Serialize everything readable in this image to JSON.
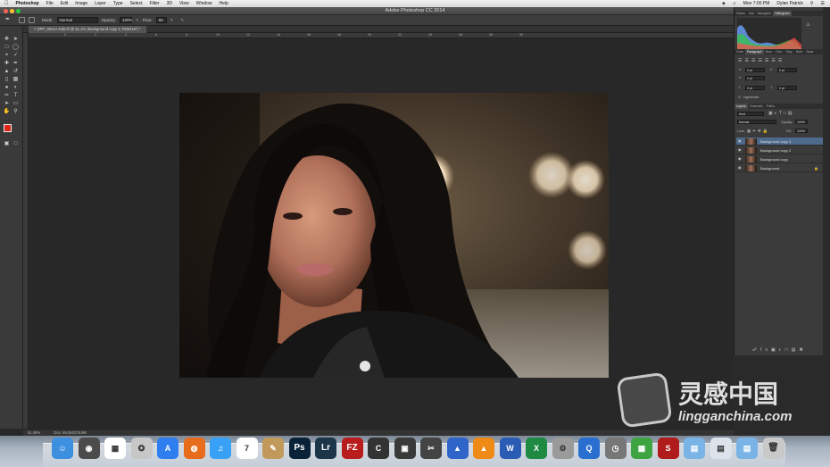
{
  "menubar": {
    "app": "Photoshop",
    "items": [
      "File",
      "Edit",
      "Image",
      "Layer",
      "Type",
      "Select",
      "Filter",
      "3D",
      "View",
      "Window",
      "Help"
    ],
    "clock": "Mon 7:00 PM",
    "user": "Dylan Patrick"
  },
  "window": {
    "title": "Adobe Photoshop CC 2014"
  },
  "options": {
    "mode_label": "Mode:",
    "mode_value": "Normal",
    "opacity_label": "Opacity:",
    "opacity_value": "100%",
    "flow_label": "Flow:",
    "flow_value": "66"
  },
  "document": {
    "tab": "DPP_0021A-Edit.tif @ 51.1% (Background copy 3, RGB/16*) *"
  },
  "ruler": {
    "marks": [
      "0",
      "2",
      "4",
      "6",
      "8",
      "10",
      "12",
      "14",
      "16",
      "18",
      "20",
      "22",
      "24",
      "26",
      "28",
      "30"
    ]
  },
  "status": {
    "zoom": "51.09%",
    "doc": "Doc: 69.0M/275.9M"
  },
  "panels": {
    "histogram_tabs": [
      "Styles",
      "Info",
      "Navigator",
      "Histogram"
    ],
    "active_histogram_tab": "Histogram",
    "para_tabs": [
      "Char",
      "Paragraph",
      "Brus",
      "Clon",
      "Glyp",
      "Note",
      "Swat"
    ],
    "active_para_tab": "Paragraph",
    "para_fields": [
      "0 pt",
      "0 pt",
      "0 pt",
      "0 pt",
      "0 pt"
    ],
    "hyphenate": "Hyphenate",
    "layers_tabs": [
      "Layers",
      "Channels",
      "Paths"
    ],
    "active_layers_tab": "Layers",
    "kind": "Kind",
    "blend": "Normal",
    "opacity_label": "Opacity:",
    "opacity_value": "100%",
    "lock_label": "Lock:",
    "fill_label": "Fill:",
    "fill_value": "100%",
    "layers": [
      {
        "name": "Background copy 3",
        "selected": true
      },
      {
        "name": "Background copy 2",
        "selected": false
      },
      {
        "name": "Background copy",
        "selected": false
      },
      {
        "name": "Background",
        "selected": false
      }
    ]
  },
  "dock": {
    "apps": [
      "Finder",
      "Dashboard",
      "Preview",
      "Safari",
      "App Store",
      "Firefox",
      "iTunes",
      "Calendar",
      "Notes",
      "Ps",
      "Lr",
      "FileZilla",
      "Cam Ranger",
      "CamRanger",
      "Final Cut",
      "Keynote",
      "VLC",
      "Word",
      "Excel",
      "Utilities",
      "QuickTime",
      "Time Machine",
      "Grapher",
      "S",
      "Folder",
      "Documents",
      "Downloads",
      "Trash"
    ]
  },
  "watermark": {
    "cn": "灵感中国",
    "en": "lingganchina.com"
  }
}
